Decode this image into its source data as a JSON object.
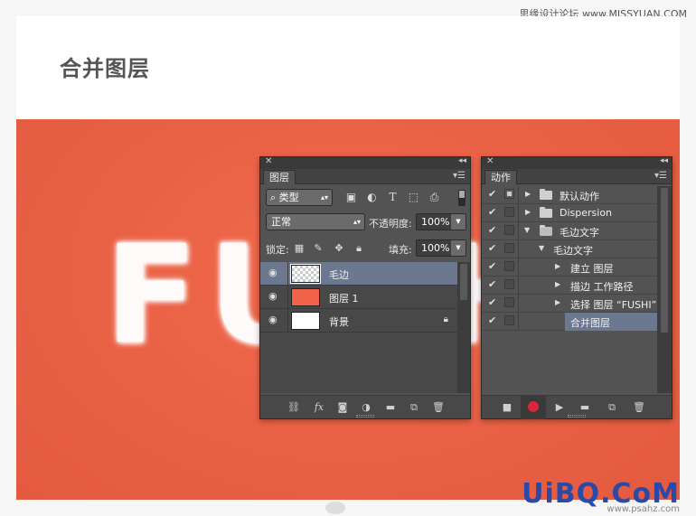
{
  "watermark_top": "思缘设计论坛 www.MISSYUAN.COM",
  "card": {
    "title": "合并图层"
  },
  "canvas": {
    "text": "FUSHI"
  },
  "bottom_logo": {
    "text": "UiBQ.CoM",
    "sub": "www.psahz.com"
  },
  "layers_panel": {
    "tab": "图层",
    "filter_kind": "类型",
    "blend_mode": "正常",
    "opacity_label": "不透明度:",
    "opacity_value": "100%",
    "lock_label": "锁定:",
    "fill_label": "填充:",
    "fill_value": "100%",
    "layers": [
      {
        "name": "毛边",
        "thumb": "transparent",
        "selected": true
      },
      {
        "name": "图层 1",
        "thumb": "red",
        "selected": false
      },
      {
        "name": "背景",
        "thumb": "white",
        "selected": false,
        "locked": true
      }
    ]
  },
  "actions_panel": {
    "tab": "动作",
    "items": [
      {
        "name": "默认动作",
        "level": 0,
        "type": "set",
        "expanded": false
      },
      {
        "name": "Dispersion",
        "level": 0,
        "type": "set",
        "expanded": false
      },
      {
        "name": "毛边文字",
        "level": 0,
        "type": "set",
        "expanded": true
      },
      {
        "name": "毛边文字",
        "level": 1,
        "type": "action",
        "expanded": true
      },
      {
        "name": "建立 图层",
        "level": 2,
        "type": "step",
        "expanded": false
      },
      {
        "name": "描边 工作路径",
        "level": 2,
        "type": "step",
        "expanded": false
      },
      {
        "name": "选择 图层 “FUSHI”",
        "level": 2,
        "type": "step",
        "expanded": false
      },
      {
        "name": "合并图层",
        "level": 3,
        "type": "step",
        "selected": true
      }
    ]
  },
  "colors": {
    "canvas_bg": "#e8603f",
    "panel_bg": "#535353",
    "selection": "#6b7890",
    "record": "#d8273b"
  }
}
